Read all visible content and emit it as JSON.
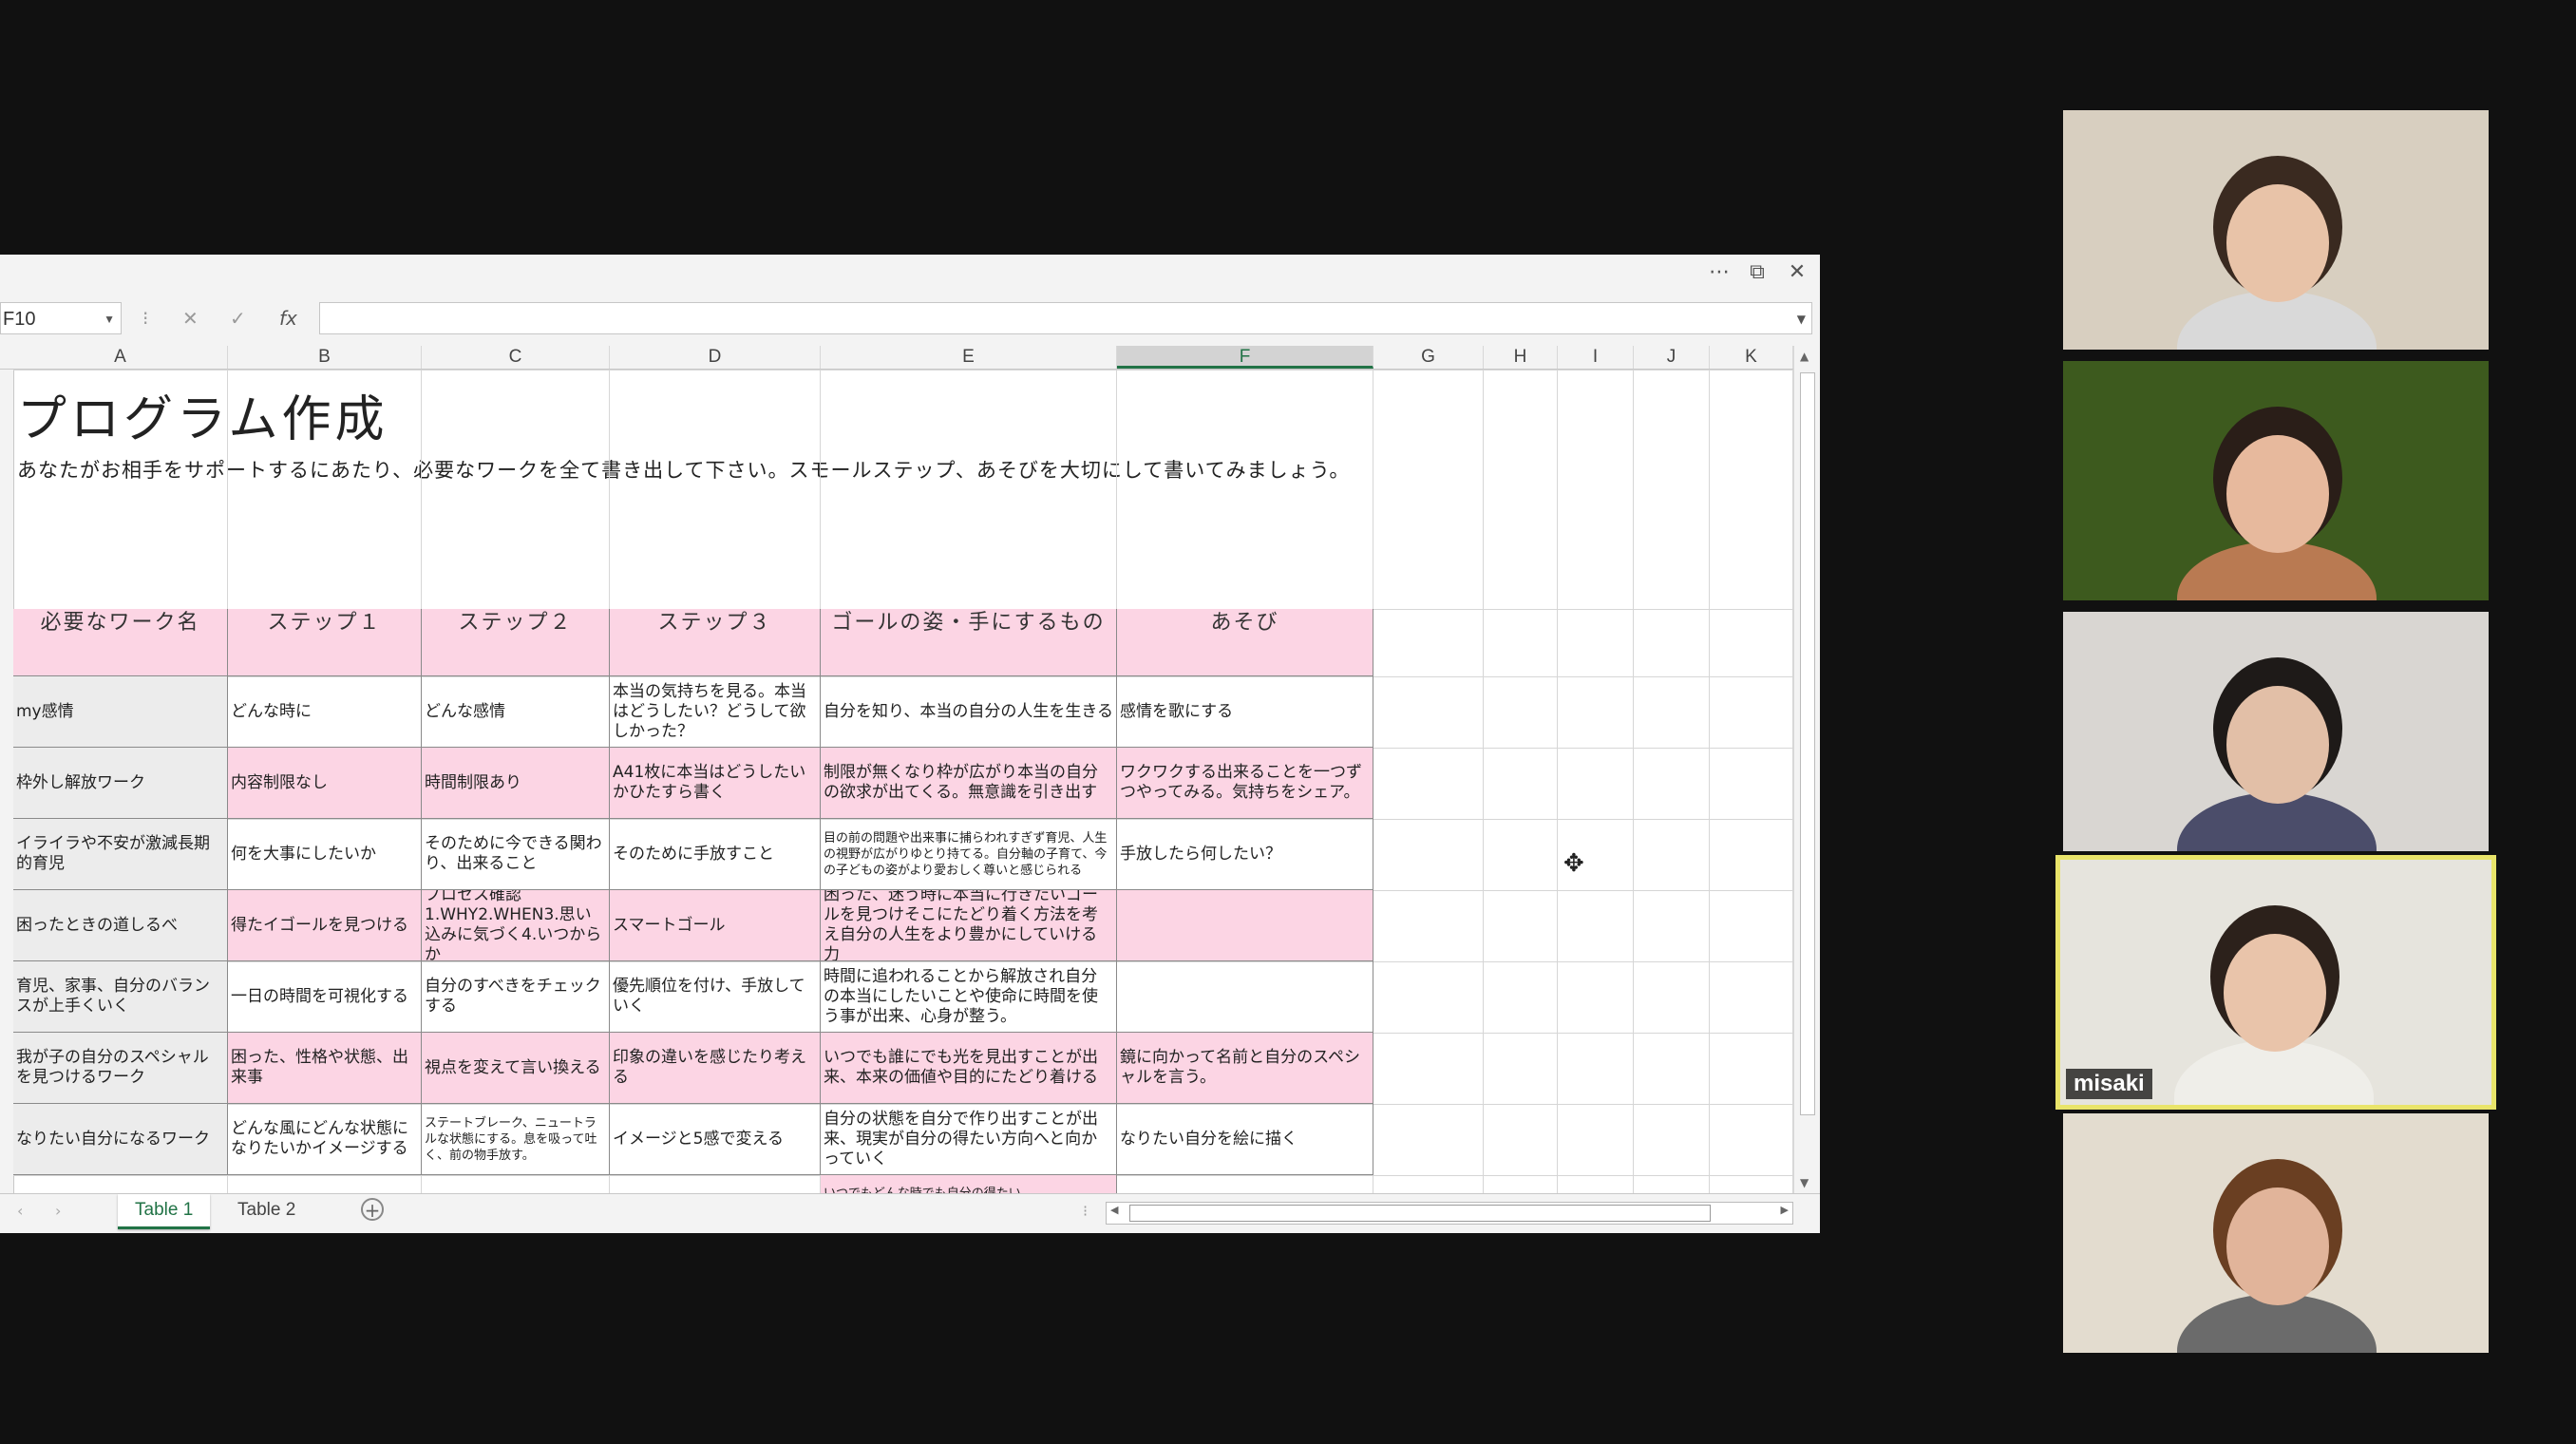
{
  "spreadsheet": {
    "name_box": "F10",
    "formula_bar_value": "",
    "columns": [
      "A",
      "B",
      "C",
      "D",
      "E",
      "F",
      "G",
      "H",
      "I",
      "J",
      "K"
    ],
    "selected_column": "F",
    "title": "プログラム作成",
    "subtitle": "あなたがお相手をサポートするにあたり、必要なワークを全て書き出して下さい。スモールステップ、あそびを大切にして書いてみましょう。",
    "table": {
      "headers": [
        "必要なワーク名",
        "ステップ１",
        "ステップ２",
        "ステップ３",
        "ゴールの姿・手にするもの",
        "あそび"
      ],
      "rows": [
        [
          "my感情",
          "どんな時に",
          "どんな感情",
          "本当の気持ちを見る。本当はどうしたい？どうして欲しかった？",
          "自分を知り、本当の自分の人生を生きる",
          "感情を歌にする"
        ],
        [
          "枠外し解放ワーク",
          "内容制限なし",
          "時間制限あり",
          "A41枚に本当はどうしたいかひたすら書く",
          "制限が無くなり枠が広がり本当の自分の欲求が出てくる。無意識を引き出す",
          "ワクワクする出来ることを一つずつやってみる。気持ちをシェア。"
        ],
        [
          "イライラや不安が激減長期的育児",
          "何を大事にしたいか",
          "そのために今できる関わり、出来ること",
          "そのために手放すこと",
          "目の前の問題や出来事に捕らわれすぎず育児、人生の視野が広がりゆとり持てる。自分軸の子育て、今の子どもの姿がより愛おしく尊いと感じられる",
          "手放したら何したい？"
        ],
        [
          "困ったときの道しるべ",
          "得たイゴールを見つける",
          "プロセス確認 1.WHY2.WHEN3.思い込みに気づく4.いつからか",
          "スマートゴール",
          "困った、迷う時に本当に行きたいゴールを見つけそこにたどり着く方法を考え自分の人生をより豊かにしていける力",
          ""
        ],
        [
          "育児、家事、自分のバランスが上手くいく",
          "一日の時間を可視化する",
          "自分のすべきをチェックする",
          "優先順位を付け、手放していく",
          "時間に追われることから解放され自分の本当にしたいことや使命に時間を使う事が出来、心身が整う。",
          ""
        ],
        [
          "我が子の自分のスペシャルを見つけるワーク",
          "困った、性格や状態、出来事",
          "視点を変えて言い換える",
          "印象の違いを感じたり考える",
          "いつでも誰にでも光を見出すことが出来、本来の価値や目的にたどり着ける",
          "鏡に向かって名前と自分のスペシャルを言う。"
        ],
        [
          "なりたい自分になるワーク",
          "どんな風にどんな状態になりたいかイメージする",
          "ステートブレーク、ニュートラルな状態にする。息を吸って吐く、前の物手放す。",
          "イメージと5感で変える",
          "自分の状態を自分で作り出すことが出来、現実が自分の得たい方向へと向かっていく",
          "なりたい自分を絵に描く"
        ]
      ],
      "partial_row_text": "いつでもどんな時でも自分の得たい…"
    },
    "sheet_tabs": [
      "Table 1",
      "Table 2"
    ],
    "active_tab": "Table 1"
  },
  "video_participants": [
    {
      "name": "",
      "bg": "#d8cfc0"
    },
    {
      "name": "",
      "bg": "#3d5a1e"
    },
    {
      "name": "",
      "bg": "#d9d6d2"
    },
    {
      "name": "misaki",
      "bg": "#e6e4dd"
    },
    {
      "name": "",
      "bg": "#e3dccf"
    }
  ],
  "icons": {
    "more": "more-options-icon",
    "restore": "restore-window-icon",
    "close": "close-icon",
    "cancel": "cancel-x-icon",
    "enter": "check-icon",
    "function": "fx-icon"
  }
}
